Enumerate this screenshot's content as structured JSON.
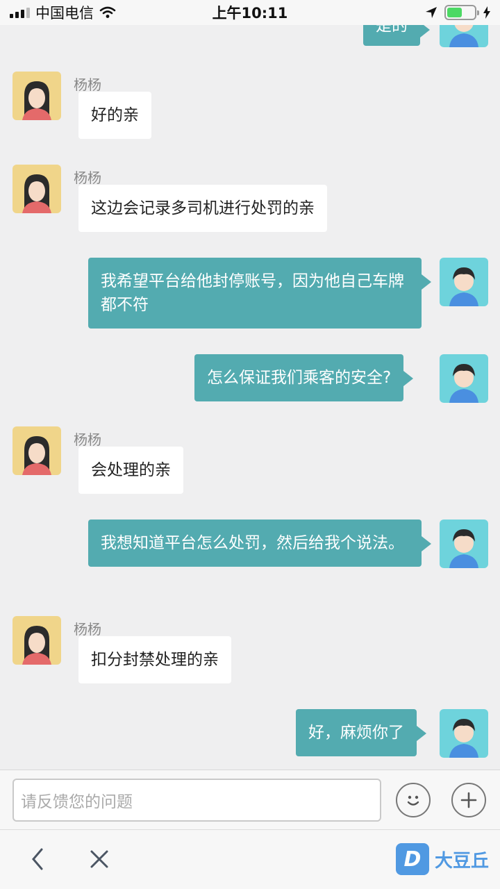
{
  "status_bar": {
    "carrier": "中国电信",
    "time": "上午10:11",
    "icons": [
      "signal-icon",
      "wifi-icon",
      "location-arrow-icon",
      "battery-icon",
      "charging-icon"
    ]
  },
  "agent_name": "杨杨",
  "messages": [
    {
      "side": "out",
      "text": "是的"
    },
    {
      "side": "in",
      "name": "杨杨",
      "text": "好的亲"
    },
    {
      "side": "in",
      "name": "杨杨",
      "text": "这边会记录多司机进行处罚的亲"
    },
    {
      "side": "out",
      "text": "我希望平台给他封停账号，因为他自己车牌都不符"
    },
    {
      "side": "out",
      "text": "怎么保证我们乘客的安全?"
    },
    {
      "side": "in",
      "name": "杨杨",
      "text": "会处理的亲"
    },
    {
      "side": "out",
      "text": "我想知道平台怎么处罚，然后给我个说法。"
    },
    {
      "side": "in",
      "name": "杨杨",
      "text": "扣分封禁处理的亲"
    },
    {
      "side": "out",
      "text": "好，麻烦你了"
    }
  ],
  "input": {
    "placeholder": "请反馈您的问题",
    "emoji_icon": "smiley-icon",
    "add_icon": "plus-icon"
  },
  "nav": {
    "back_icon": "chevron-left-icon",
    "close_icon": "close-icon",
    "share_icon": "share-icon"
  },
  "watermark": {
    "logo_letter": "D",
    "text": "大豆丘"
  },
  "colors": {
    "outgoing_bubble": "#53abb0",
    "incoming_bubble": "#ffffff",
    "background": "#efeff0",
    "girl_avatar_bg": "#f0d58a",
    "boy_avatar_bg": "#6ed3dc"
  }
}
